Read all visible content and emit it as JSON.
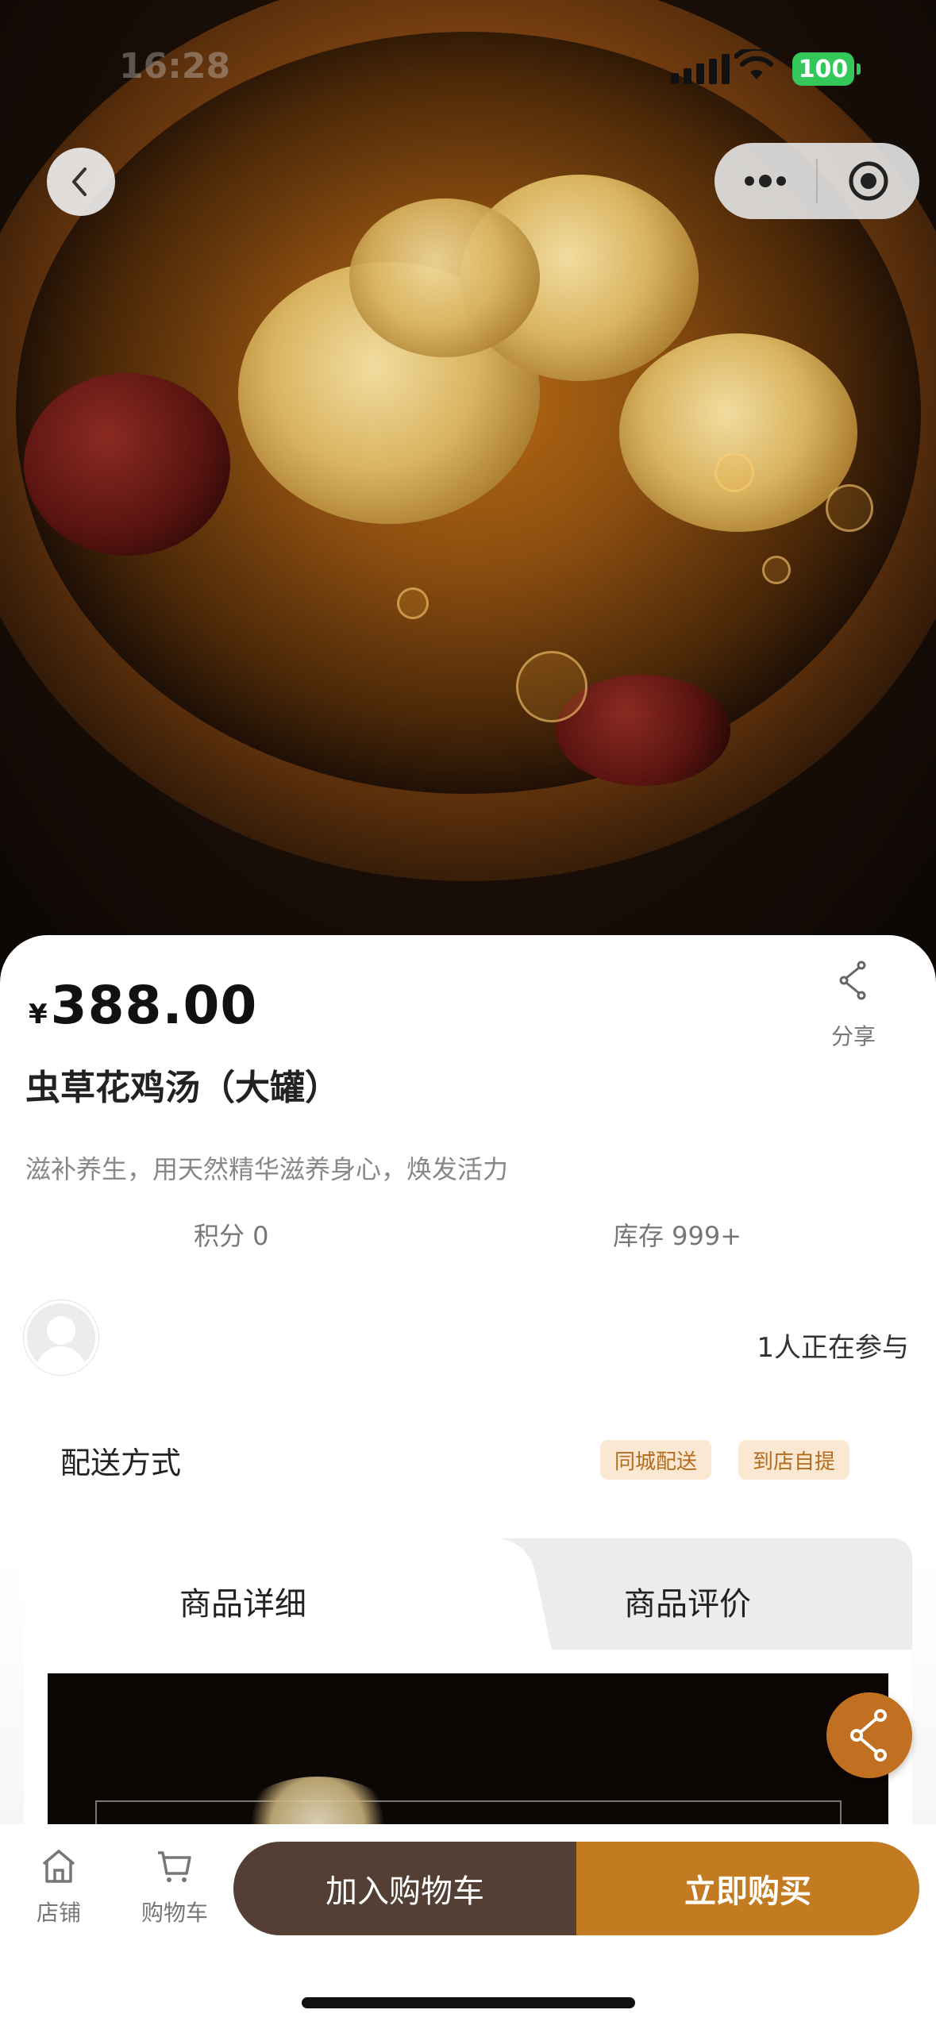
{
  "status_bar": {
    "time": "16:28",
    "battery": "100"
  },
  "nav": {
    "back_icon": "chevron-left-icon",
    "more_icon": "more-dots-icon",
    "close_icon": "target-icon"
  },
  "product": {
    "currency": "¥",
    "price": "388.00",
    "title": "虫草花鸡汤（大罐）",
    "subtitle": "滋补养生，用天然精华滋养身心，焕发活力",
    "points": "积分 0",
    "stock": "库存 999+",
    "share_label": "分享",
    "participants": "1人正在参与"
  },
  "delivery": {
    "label": "配送方式",
    "options": [
      "同城配送",
      "到店自提"
    ]
  },
  "tabs": [
    "商品详细",
    "商品评价"
  ],
  "bottom_nav": {
    "store_label": "店铺",
    "cart_label": "购物车",
    "add_to_cart": "加入购物车",
    "buy_now": "立即购买"
  },
  "colors": {
    "accent": "#c27b20",
    "cart_button": "#533f34",
    "battery": "#34c759",
    "tag_bg": "#fbe8d2",
    "tag_text": "#b36b1e"
  }
}
